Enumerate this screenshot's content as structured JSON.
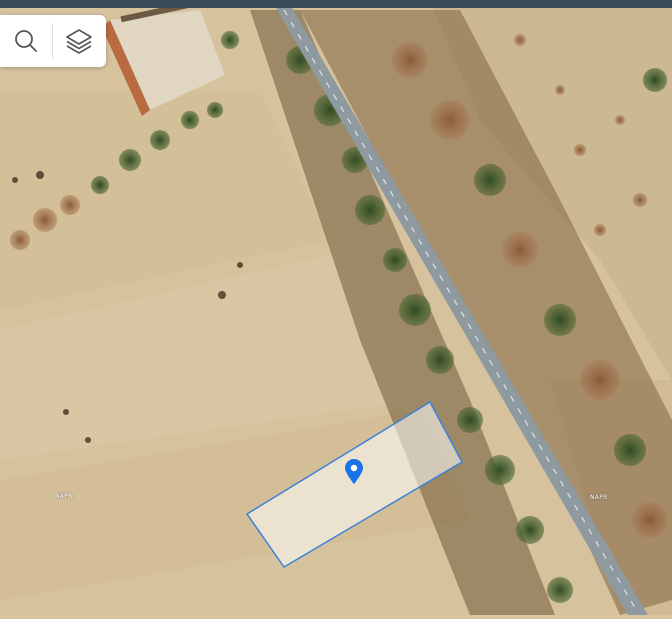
{
  "toolbar": {
    "search_icon": "search-icon",
    "layers_icon": "layers-icon"
  },
  "map": {
    "labels": [
      "NAPR",
      "NAPR"
    ],
    "colors": {
      "parcel_outline": "#3b82d6",
      "marker": "#1a73e8",
      "road": "#8e9aa0",
      "field": "#d8c5a0"
    }
  }
}
